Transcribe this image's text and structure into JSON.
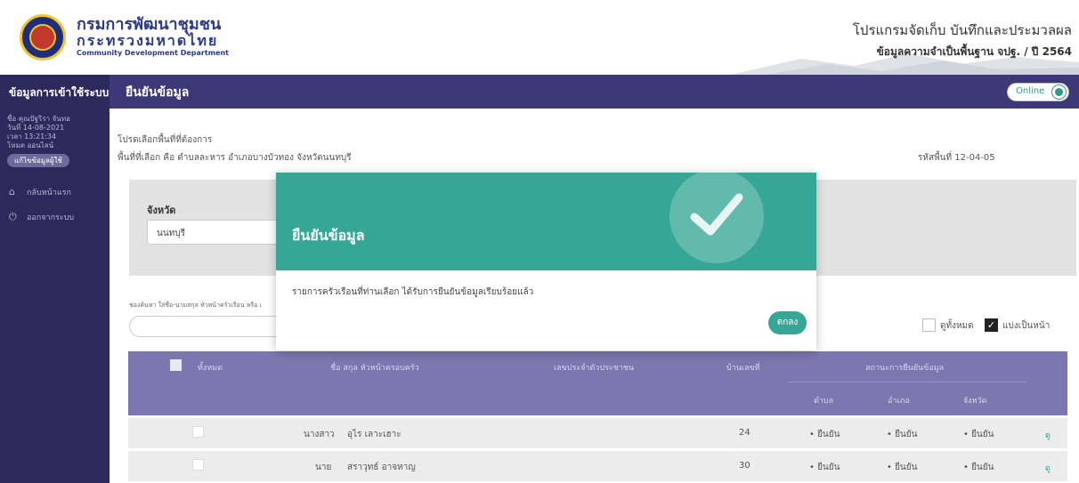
{
  "header": {
    "org_title": "กรมการพัฒนาชุมชน",
    "org_subtitle": "กระทรวงมหาดไทย",
    "org_english": "Community Development Department",
    "program_title": "โปรแกรมจัดเก็บ บันทึกและประมวลผล",
    "program_subtitle": "ข้อมูลความจำเป็นพื้นฐาน จปฐ. / ปี 2564"
  },
  "topbar": {
    "sidebar_title": "ข้อมูลการเข้าใช้ระบบ",
    "page_title": "ยืนยันข้อมูล",
    "status_label": "Online"
  },
  "sidebar": {
    "user_name": "ชื่อ คุณปัฐริรา จันทอ",
    "date": "วันที่ 14-08-2021",
    "time": "เวลา 13:21:34",
    "mode": "โหมด ออนไลน์",
    "edit_label": "แก้ไขข้อมูลผู้ใช้",
    "items": [
      {
        "icon": "⌂",
        "label": "กลับหน้าแรก"
      },
      {
        "icon": "⏻",
        "label": "ออกจากระบบ"
      }
    ]
  },
  "main": {
    "instruction": "โปรดเลือกพื้นที่ที่ต้องการ",
    "selected_area": "พื้นที่ที่เลือก คือ ตำบลละหาร อำเภอบางบัวทอง จังหวัดนนทบุรี",
    "area_code": "รหัสพื้นที่ 12-04-05",
    "province_label": "จังหวัด",
    "province_value": "นนทบุรี",
    "search_label": "ช่องค้นหา ใส่ชื่อ-นามสกุล หัวหน้าครัวเรือน หรือ เ",
    "show_all_label": "ดูทั้งหมด",
    "paginate_label": "แบ่งเป็นหน้า"
  },
  "table": {
    "headers": {
      "all": "ทั้งหมด",
      "name": "ชื่อ สกุล หัวหน้าครอบครัว",
      "id": "เลขประจำตัวประชาชน",
      "house": "บ้านเลขที่",
      "status": "สถานะการยืนยันข้อมูล",
      "tambon": "ตำบล",
      "amphoe": "อำเภอ",
      "province": "จังหวัด"
    },
    "rows": [
      {
        "title": "นางสาว",
        "name": "อุไร เลาะเฮาะ",
        "house": "24",
        "tambon": "• ยืนยัน",
        "amphoe": "• ยืนยัน",
        "province": "• ยืนยัน",
        "view": "ดู"
      },
      {
        "title": "นาย",
        "name": "สราวุทธ์ อาจหาญ",
        "house": "30",
        "tambon": "• ยืนยัน",
        "amphoe": "• ยืนยัน",
        "province": "• ยืนยัน",
        "view": "ดู"
      }
    ]
  },
  "modal": {
    "title": "ยืนยันข้อมูล",
    "message": "รายการครัวเรือนที่ท่านเลือก ได้รับการยืนยันข้อมูลเรียบร้อยแล้ว",
    "ok_label": "ตกลง"
  },
  "colors": {
    "primary": "#3d3878",
    "sidebar": "#2c295c",
    "accent": "#36a797",
    "table_header": "#7c77ae"
  }
}
